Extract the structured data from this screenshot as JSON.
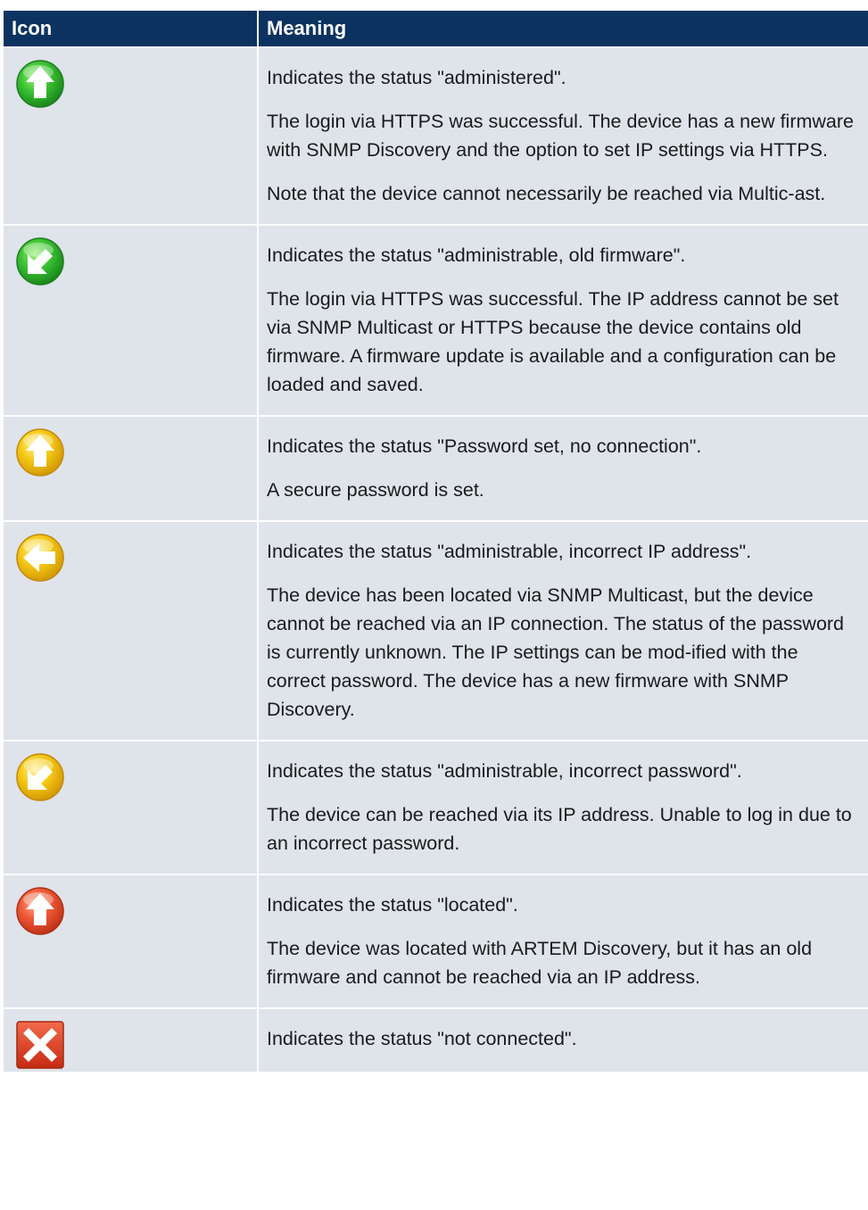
{
  "table": {
    "header": {
      "icon": "Icon",
      "meaning": "Meaning"
    },
    "rows": [
      {
        "icon": "green-up-arrow-icon",
        "paragraphs": [
          "Indicates the status \"administered\".",
          "The login via HTTPS was successful. The device has a new firmware with SNMP Discovery and the option to set IP settings via HTTPS.",
          "Note that the device cannot necessarily be reached via Multic-ast."
        ]
      },
      {
        "icon": "green-down-left-arrow-icon",
        "paragraphs": [
          "Indicates the status \"administrable, old firmware\".",
          "The login via HTTPS was successful. The IP address cannot be set via SNMP Multicast or HTTPS because the device contains old firmware. A firmware update is available and a configuration can be loaded and saved."
        ]
      },
      {
        "icon": "yellow-up-arrow-icon",
        "paragraphs": [
          "Indicates the status \"Password set, no connection\".",
          "A secure password is set."
        ]
      },
      {
        "icon": "yellow-left-arrow-icon",
        "paragraphs": [
          "Indicates the status \"administrable, incorrect IP address\".",
          "The device has been located via SNMP Multicast, but the device cannot be reached via an IP connection. The status of the password is currently unknown. The IP settings can be mod-ified with the correct password. The device has a new firmware with SNMP Discovery."
        ]
      },
      {
        "icon": "yellow-down-left-arrow-icon",
        "paragraphs": [
          "Indicates the status \"administrable, incorrect password\".",
          "The device can be reached via its IP address. Unable to log in due to an incorrect password."
        ]
      },
      {
        "icon": "red-up-arrow-icon",
        "paragraphs": [
          "Indicates the status \"located\".",
          "The device was located with ARTEM Discovery, but it has an old firmware and cannot be reached via an IP address."
        ]
      },
      {
        "icon": "red-x-icon",
        "paragraphs": [
          "Indicates the status \"not connected\"."
        ]
      }
    ]
  },
  "colors": {
    "header_bg": "#0c3360",
    "row_bg": "#dfe3ea",
    "green": "#2fb52d",
    "yellow": "#f1be08",
    "red": "#e6462a"
  }
}
